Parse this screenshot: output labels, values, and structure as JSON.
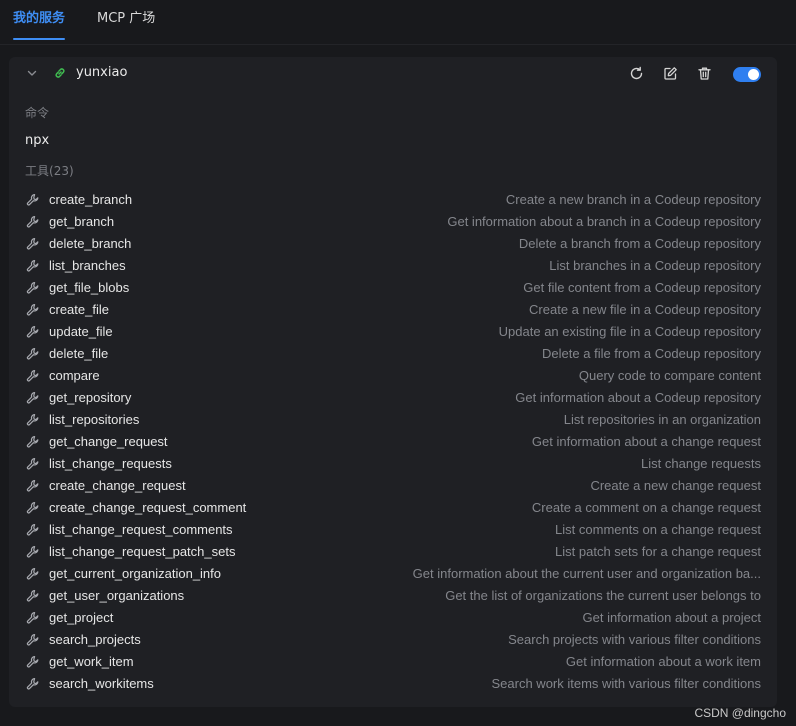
{
  "tabs": [
    {
      "label": "我的服务",
      "active": true
    },
    {
      "label": "MCP 广场",
      "active": false
    }
  ],
  "server": {
    "name": "yunxiao",
    "enabled": true,
    "actions": [
      "refresh-icon",
      "edit-icon",
      "delete-icon"
    ]
  },
  "command": {
    "label": "命令",
    "value": "npx"
  },
  "tools": {
    "heading": "工具",
    "count": "(23)",
    "items": [
      {
        "name": "create_branch",
        "desc": "Create a new branch in a Codeup repository"
      },
      {
        "name": "get_branch",
        "desc": "Get information about a branch in a Codeup repository"
      },
      {
        "name": "delete_branch",
        "desc": "Delete a branch from a Codeup repository"
      },
      {
        "name": "list_branches",
        "desc": "List branches in a Codeup repository"
      },
      {
        "name": "get_file_blobs",
        "desc": "Get file content from a Codeup repository"
      },
      {
        "name": "create_file",
        "desc": "Create a new file in a Codeup repository"
      },
      {
        "name": "update_file",
        "desc": "Update an existing file in a Codeup repository"
      },
      {
        "name": "delete_file",
        "desc": "Delete a file from a Codeup repository"
      },
      {
        "name": "compare",
        "desc": "Query code to compare content"
      },
      {
        "name": "get_repository",
        "desc": "Get information about a Codeup repository"
      },
      {
        "name": "list_repositories",
        "desc": "List repositories in an organization"
      },
      {
        "name": "get_change_request",
        "desc": "Get information about a change request"
      },
      {
        "name": "list_change_requests",
        "desc": "List change requests"
      },
      {
        "name": "create_change_request",
        "desc": "Create a new change request"
      },
      {
        "name": "create_change_request_comment",
        "desc": "Create a comment on a change request"
      },
      {
        "name": "list_change_request_comments",
        "desc": "List comments on a change request"
      },
      {
        "name": "list_change_request_patch_sets",
        "desc": "List patch sets for a change request"
      },
      {
        "name": "get_current_organization_info",
        "desc": "Get information about the current user and organization ba..."
      },
      {
        "name": "get_user_organizations",
        "desc": "Get the list of organizations the current user belongs to"
      },
      {
        "name": "get_project",
        "desc": "Get information about a project"
      },
      {
        "name": "search_projects",
        "desc": "Search projects with various filter conditions"
      },
      {
        "name": "get_work_item",
        "desc": "Get information about a work item"
      },
      {
        "name": "search_workitems",
        "desc": "Search work items with various filter conditions"
      }
    ]
  },
  "watermark": "CSDN @dingcho",
  "colors": {
    "accent": "#3e8df3",
    "link_icon": "#3fb950",
    "background": "#18191c",
    "card": "#1f2024"
  }
}
